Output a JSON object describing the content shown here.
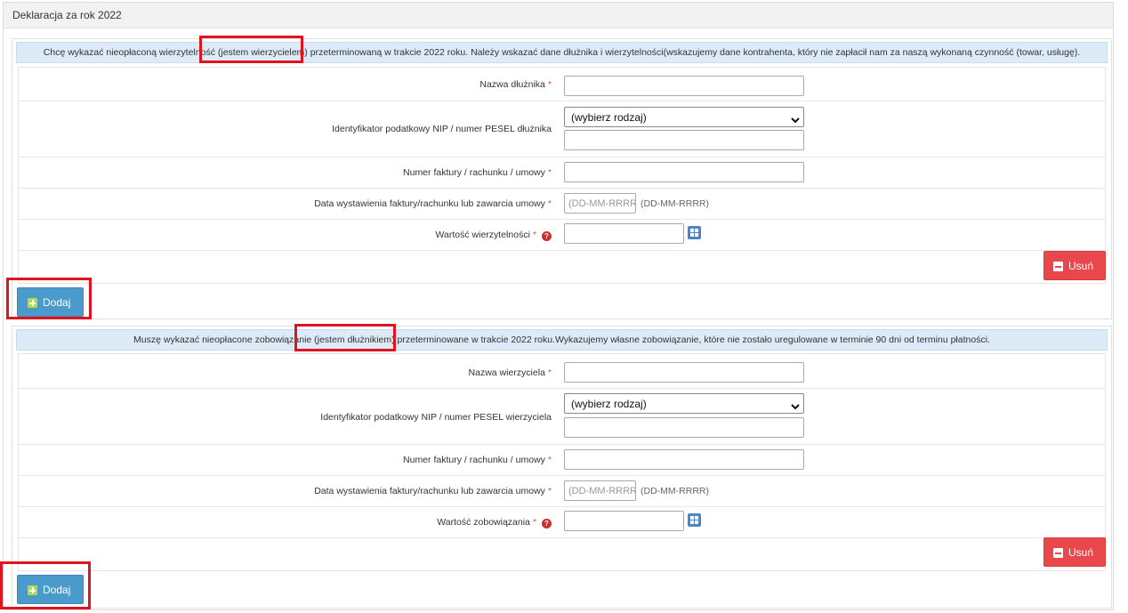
{
  "panel": {
    "title": "Deklaracja za rok 2022"
  },
  "creditor_section": {
    "info_prefix": "Chcę wykazać nieopłaconą wierzytelność ",
    "info_highlight": "(jestem wierzycielem)",
    "info_suffix": " przeterminowaną w trakcie 2022 roku. Należy wskazać dane dłużnika i wierzytelności(wskazujemy dane kontrahenta, który nie zapłacił nam za naszą wykonaną czynność (towar, usługę).",
    "name_label": "Nazwa dłużnika",
    "id_label": "Identyfikator podatkowy NIP / numer PESEL dłużnika",
    "id_select_value": "(wybierz rodzaj)",
    "invoice_label": "Numer faktury / rachunku / umowy",
    "date_label": "Data wystawienia faktury/rachunku lub zawarcia umowy",
    "date_placeholder": "(DD-MM-RRRR)",
    "date_hint": "(DD-MM-RRRR)",
    "amount_label": "Wartość wierzytelności",
    "required_mark": "*",
    "help_mark": "?",
    "delete_label": "Usuń",
    "add_label": "Dodaj"
  },
  "debtor_section": {
    "info_prefix": "Muszę wykazać nieopłacone zobowiązanie ",
    "info_highlight": "(jestem dłużnikiem)",
    "info_suffix": " przeterminowane w trakcie 2022 roku.Wykazujemy własne zobowiązanie, które nie zostało uregulowane w terminie 90 dni od terminu płatności.",
    "name_label": "Nazwa wierzyciela",
    "id_label": "Identyfikator podatkowy NIP / numer PESEL wierzyciela",
    "id_select_value": "(wybierz rodzaj)",
    "invoice_label": "Numer faktury / rachunku / umowy",
    "date_label": "Data wystawienia faktury/rachunku lub zawarcia umowy",
    "date_placeholder": "(DD-MM-RRRR)",
    "date_hint": "(DD-MM-RRRR)",
    "amount_label": "Wartość zobowiązania",
    "required_mark": "*",
    "help_mark": "?",
    "delete_label": "Usuń",
    "add_label": "Dodaj"
  },
  "colors": {
    "accent_red": "#e0141e",
    "info_bg": "#ddeaf7",
    "delete_btn": "#e8474c",
    "add_btn": "#4a9acb"
  },
  "icons": [
    "minus-icon",
    "plus-icon",
    "calculator-icon",
    "help-icon",
    "chevron-down-icon"
  ]
}
